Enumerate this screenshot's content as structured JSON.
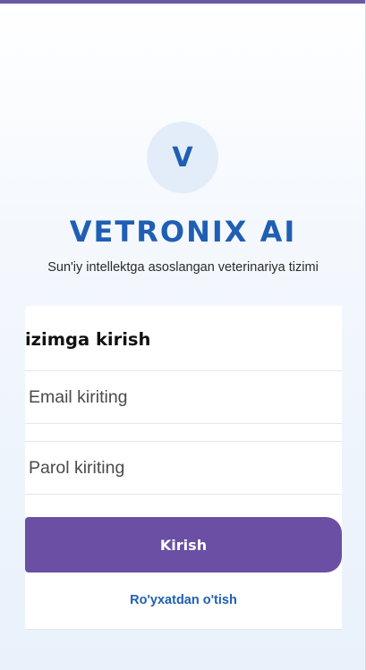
{
  "app": {
    "logo_letter": "V",
    "title": "VETRONIX AI",
    "subtitle": "Sun'iy intellektga asoslangan veterinariya tizimi"
  },
  "login_form": {
    "heading": "izimga kirish",
    "email_placeholder": "Email kiriting",
    "email_value": "",
    "password_placeholder": "Parol kiriting",
    "password_value": "",
    "submit_label": "Kirish",
    "register_link": "Ro'yxatdan o'tish"
  },
  "colors": {
    "brand_blue": "#1f5fb3",
    "button_purple": "#6a4fa4",
    "logo_background": "#e3edf9"
  }
}
